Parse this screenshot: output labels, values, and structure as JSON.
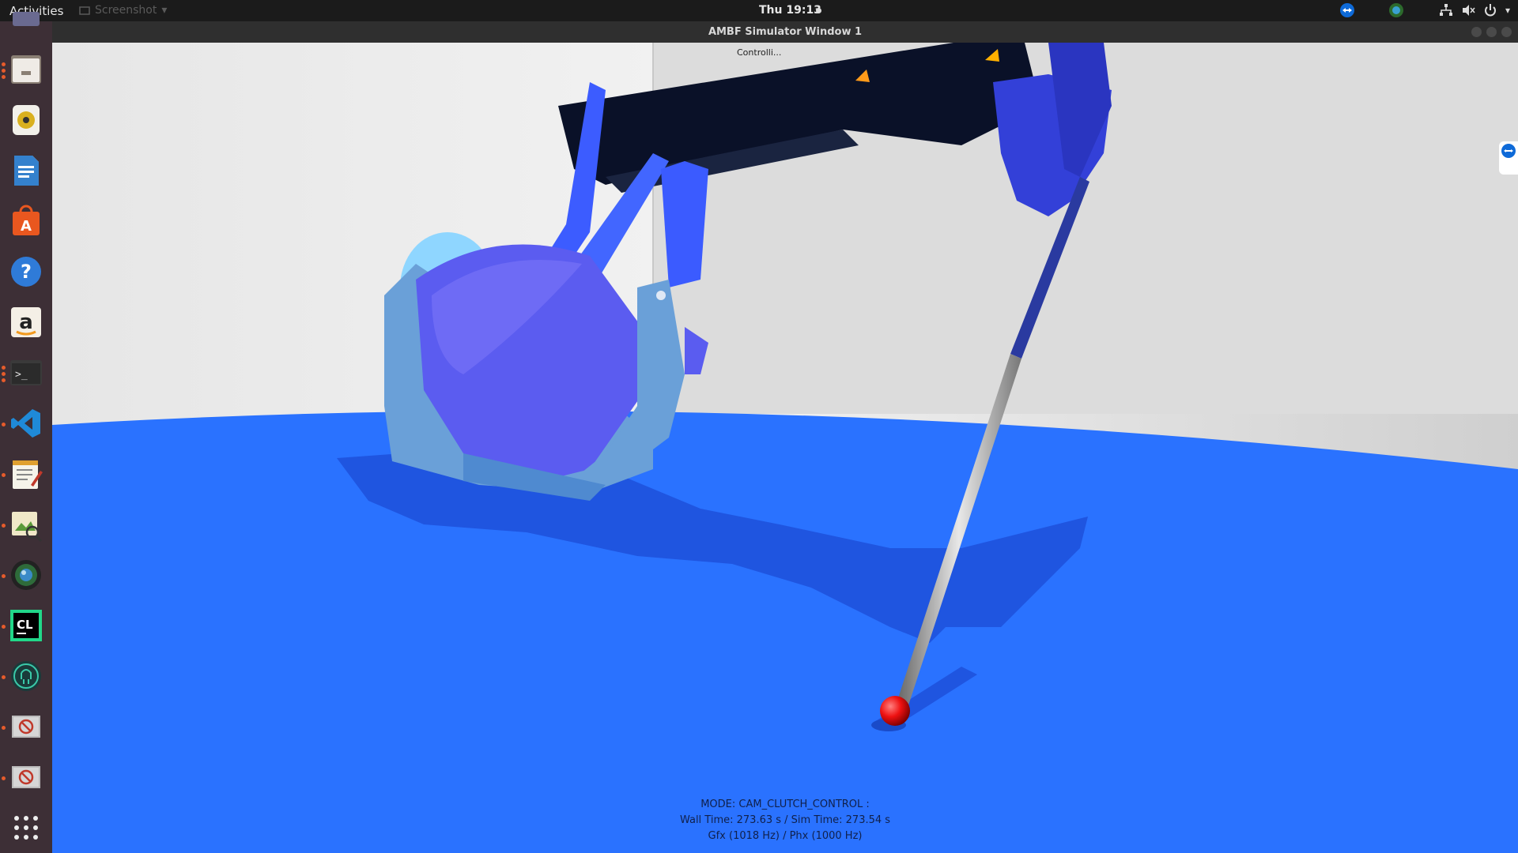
{
  "topbar": {
    "activities": "Activities",
    "app_menu": "Screenshot",
    "clock": "Thu 19:13"
  },
  "dock": {
    "items": [
      {
        "name": "files-icon",
        "running": true
      },
      {
        "name": "rhythmbox-icon",
        "running": false
      },
      {
        "name": "writer-icon",
        "running": false
      },
      {
        "name": "software-center-icon",
        "running": false
      },
      {
        "name": "help-icon",
        "running": false
      },
      {
        "name": "amazon-icon",
        "running": false
      },
      {
        "name": "terminal-icon",
        "running": true
      },
      {
        "name": "vscode-icon",
        "running": true
      },
      {
        "name": "text-editor-icon",
        "running": true
      },
      {
        "name": "image-viewer-icon",
        "running": true
      },
      {
        "name": "camera-icon",
        "running": true
      },
      {
        "name": "clion-icon",
        "running": true
      },
      {
        "name": "gitkraken-icon",
        "running": true
      },
      {
        "name": "blocked-app-icon",
        "running": true
      },
      {
        "name": "blocked-app-icon-2",
        "running": true
      },
      {
        "name": "show-apps-icon",
        "running": false
      }
    ]
  },
  "window": {
    "title": "AMBF Simulator Window 1",
    "controller_label": "Controlli..."
  },
  "hud": {
    "mode": "MODE: CAM_CLUTCH_CONTROL :",
    "time": "Wall Time: 273.63 s / Sim Time: 273.54 s",
    "rates": "Gfx (1018 Hz) / Phx (1000 Hz)"
  },
  "colors": {
    "floor": "#2a72ff",
    "wall": "#d9d9d9",
    "robot_blue": "#3b5bff",
    "robot_dark": "#1a1f5a",
    "tool_tip": "#ff1a1a"
  }
}
